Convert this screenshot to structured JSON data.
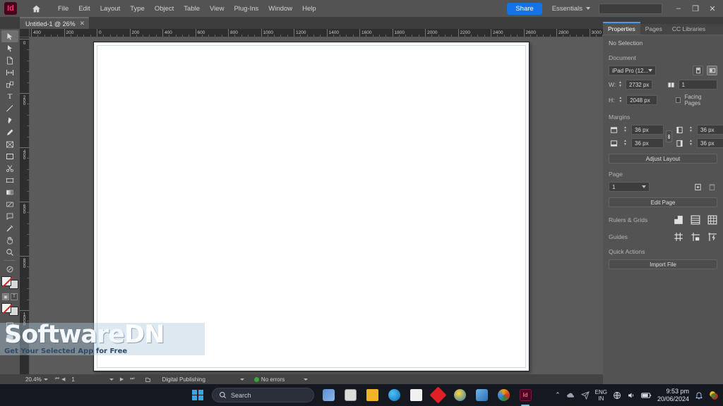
{
  "app": {
    "name": "Adobe InDesign",
    "logo_text": "Id",
    "accent": "#1473e6",
    "brand_color": "#49021f"
  },
  "menubar": {
    "home_icon": "home-icon",
    "items": [
      "File",
      "Edit",
      "Layout",
      "Type",
      "Object",
      "Table",
      "View",
      "Plug-Ins",
      "Window",
      "Help"
    ],
    "share_label": "Share",
    "workspace": "Essentials",
    "search_placeholder": "",
    "window_controls": {
      "minimize": "–",
      "restore": "❐",
      "close": "✕"
    }
  },
  "document_tab": {
    "label": "Untitled-1 @ 26%",
    "close": "✕"
  },
  "toolbar": {
    "tools": [
      {
        "name": "selection-tool",
        "glyph": "selection",
        "active": true
      },
      {
        "name": "direct-selection-tool",
        "glyph": "direct-selection",
        "active": false
      },
      {
        "name": "page-tool",
        "glyph": "page",
        "active": false
      },
      {
        "name": "gap-tool",
        "glyph": "gap",
        "active": false
      },
      {
        "name": "content-collector-tool",
        "glyph": "collector",
        "active": false
      },
      {
        "name": "type-tool",
        "glyph": "type",
        "active": false
      },
      {
        "name": "line-tool",
        "glyph": "line",
        "active": false
      },
      {
        "name": "pen-tool",
        "glyph": "pen",
        "active": false
      },
      {
        "name": "pencil-tool",
        "glyph": "pencil",
        "active": false
      },
      {
        "name": "frame-tool",
        "glyph": "frame",
        "active": false
      },
      {
        "name": "rectangle-tool",
        "glyph": "rectangle",
        "active": false
      },
      {
        "name": "scissors-tool",
        "glyph": "scissors",
        "active": false
      },
      {
        "name": "free-transform-tool",
        "glyph": "transform",
        "active": false
      },
      {
        "name": "gradient-swatch-tool",
        "glyph": "gradient",
        "active": false
      },
      {
        "name": "gradient-feather-tool",
        "glyph": "feather",
        "active": false
      },
      {
        "name": "note-tool",
        "glyph": "note",
        "active": false
      },
      {
        "name": "color-theme-tool",
        "glyph": "eyedropper",
        "active": false
      },
      {
        "name": "hand-tool",
        "glyph": "hand",
        "active": false
      },
      {
        "name": "zoom-tool",
        "glyph": "zoom",
        "active": false
      }
    ],
    "swatch": {
      "fill": "#f2f2f2",
      "stroke": "#d9d9d9",
      "none_indicator": "#e02020"
    },
    "mode_buttons": [
      "normal-mode",
      "preview-mode"
    ],
    "apply_buttons": [
      "apply-color",
      "apply-gradient",
      "apply-none"
    ]
  },
  "rulers": {
    "unit": "px",
    "horizontal_ticks": [
      "400",
      "200",
      "0",
      "200",
      "400",
      "600",
      "800",
      "1000",
      "1200",
      "1400",
      "1600",
      "1800",
      "2000",
      "2200",
      "2400",
      "2600",
      "2800",
      "3000"
    ],
    "vertical_ticks": [
      "0",
      "200",
      "400",
      "600",
      "800",
      "1000"
    ]
  },
  "canvas": {
    "page_background": "#ffffff",
    "pasteboard_background": "#5b5b5b",
    "margin_guide_color": "#cfd9e8"
  },
  "statusbar": {
    "zoom": "20.4%",
    "page_number": "1",
    "workspace_mode": "Digital Publishing",
    "preflight_status": "No errors",
    "preflight_color": "#3ea33e",
    "nav_first": "⏮",
    "nav_prev": "◀",
    "nav_next": "▶",
    "nav_last": "⏭"
  },
  "panel": {
    "tabs": [
      {
        "label": "Properties",
        "active": true
      },
      {
        "label": "Pages",
        "active": false
      },
      {
        "label": "CC Libraries",
        "active": false
      }
    ],
    "selection_state": "No Selection",
    "document": {
      "section_label": "Document",
      "preset": "iPad Pro (12...",
      "preset_caret": "⌄",
      "width_label": "W:",
      "width_value": "2732 px",
      "height_label": "H:",
      "height_value": "2048 px",
      "pages_value": "1",
      "facing_pages_label": "Facing Pages",
      "facing_pages_checked": false,
      "orientation_portrait": "portrait-icon",
      "orientation_landscape": "landscape-icon"
    },
    "margins": {
      "section_label": "Margins",
      "top": "36 px",
      "bottom": "36 px",
      "left": "36 px",
      "right": "36 px",
      "link_icon": "chain-link-icon",
      "adjust_layout_label": "Adjust Layout"
    },
    "page": {
      "section_label": "Page",
      "current": "1",
      "caret": "⌄",
      "add_page_icon": "add-page-icon",
      "delete_page_icon": "delete-page-icon",
      "edit_page_label": "Edit Page"
    },
    "rulers_grids": {
      "label": "Rulers & Grids",
      "icons": [
        "show-rulers-icon",
        "baseline-grid-icon",
        "document-grid-icon"
      ]
    },
    "guides": {
      "label": "Guides",
      "icons": [
        "show-guides-icon",
        "lock-guides-icon",
        "smart-guides-icon"
      ]
    },
    "quick_actions": {
      "label": "Quick Actions",
      "import_file_label": "Import File"
    }
  },
  "watermark": {
    "title_main": "Software",
    "title_accent": "DN",
    "subtitle": "Get Your Selected App for Free"
  },
  "taskbar": {
    "start_icon": "windows-start-icon",
    "search_placeholder": "Search",
    "search_icon": "search-icon",
    "apps": [
      {
        "name": "widgets-icon",
        "color": "#5b8dd4",
        "text": ""
      },
      {
        "name": "file-explorer-icon",
        "color": "#d8d8d8",
        "text": ""
      },
      {
        "name": "folder-icon",
        "color": "#f0b429",
        "text": ""
      },
      {
        "name": "edge-icon",
        "color": "#1b84c9",
        "text": ""
      },
      {
        "name": "store-icon",
        "color": "#eeeeee",
        "text": ""
      },
      {
        "name": "photoshop-express-icon",
        "color": "#e01f26",
        "text": ""
      },
      {
        "name": "chrome-beta-icon",
        "color": "#3b7ddd",
        "text": ""
      },
      {
        "name": "illustrator-icon",
        "color": "#2a6fb5",
        "text": ""
      },
      {
        "name": "chrome-icon",
        "color": "#e8a013",
        "text": ""
      },
      {
        "name": "indesign-icon",
        "color": "#49021f",
        "text": "Id",
        "active": true
      }
    ],
    "tray": {
      "chevron": "⌃",
      "network_icon": "network-icon",
      "onedrive_icon": "onedrive-icon",
      "language_line1": "ENG",
      "language_line2": "IN",
      "globe_icon": "globe-icon",
      "volume_icon": "volume-icon",
      "battery_icon": "battery-icon",
      "time": "9:53 pm",
      "date": "20/06/2024",
      "notification_icon": "bell-icon",
      "tray_app_icon": "antivirus-icon"
    }
  }
}
